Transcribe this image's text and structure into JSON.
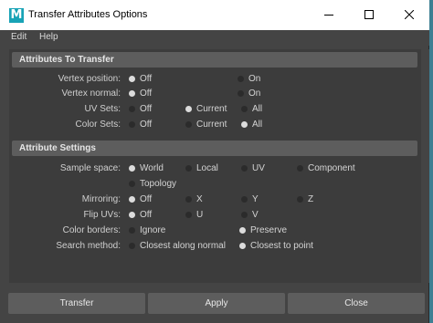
{
  "window": {
    "title": "Transfer Attributes Options",
    "icon_letter": "M"
  },
  "menu": [
    "Edit",
    "Help"
  ],
  "sections": {
    "transfer": "Attributes To Transfer",
    "settings": "Attribute Settings"
  },
  "rows": {
    "vertex_position": {
      "label": "Vertex position:",
      "options": [
        "Off",
        "On"
      ],
      "selected": "Off"
    },
    "vertex_normal": {
      "label": "Vertex normal:",
      "options": [
        "Off",
        "On"
      ],
      "selected": "Off"
    },
    "uv_sets": {
      "label": "UV Sets:",
      "options": [
        "Off",
        "Current",
        "All"
      ],
      "selected": "Current"
    },
    "color_sets": {
      "label": "Color Sets:",
      "options": [
        "Off",
        "Current",
        "All"
      ],
      "selected": "All"
    },
    "sample_space": {
      "label": "Sample space:",
      "options": [
        "World",
        "Local",
        "UV",
        "Component",
        "Topology"
      ],
      "selected": "World"
    },
    "mirroring": {
      "label": "Mirroring:",
      "options": [
        "Off",
        "X",
        "Y",
        "Z"
      ],
      "selected": "Off"
    },
    "flip_uvs": {
      "label": "Flip UVs:",
      "options": [
        "Off",
        "U",
        "V"
      ],
      "selected": "Off"
    },
    "color_borders": {
      "label": "Color borders:",
      "options": [
        "Ignore",
        "Preserve"
      ],
      "selected": "Preserve"
    },
    "search_method": {
      "label": "Search method:",
      "options": [
        "Closest along normal",
        "Closest to point"
      ],
      "selected": "Closest to point"
    }
  },
  "buttons": {
    "transfer": "Transfer",
    "apply": "Apply",
    "close": "Close"
  }
}
